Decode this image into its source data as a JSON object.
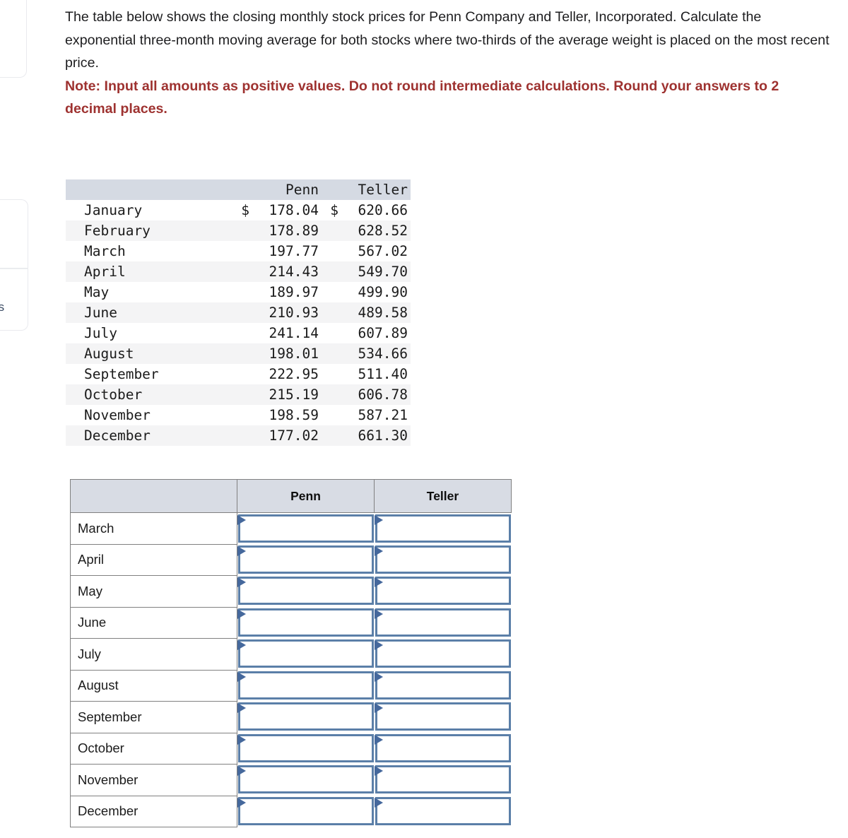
{
  "prompt": {
    "body": "The table below shows the closing monthly stock prices for Penn Company and Teller, Incorporated. Calculate the exponential three-month moving average for both stocks where two-thirds of the average weight is placed on the most recent price.",
    "note": "Note: Input all amounts as positive values. Do not round intermediate calculations. Round your answers to 2 decimal places.",
    "note_color": "#9e3230"
  },
  "edge_cards": {
    "bottom_label": "es"
  },
  "price_table": {
    "headers": [
      "",
      "Penn",
      "Teller"
    ],
    "currency_symbol": "$",
    "rows": [
      {
        "month": "January",
        "penn": "178.04",
        "teller": "620.66",
        "currency": true
      },
      {
        "month": "February",
        "penn": "178.89",
        "teller": "628.52",
        "currency": false
      },
      {
        "month": "March",
        "penn": "197.77",
        "teller": "567.02",
        "currency": false
      },
      {
        "month": "April",
        "penn": "214.43",
        "teller": "549.70",
        "currency": false
      },
      {
        "month": "May",
        "penn": "189.97",
        "teller": "499.90",
        "currency": false
      },
      {
        "month": "June",
        "penn": "210.93",
        "teller": "489.58",
        "currency": false
      },
      {
        "month": "July",
        "penn": "241.14",
        "teller": "607.89",
        "currency": false
      },
      {
        "month": "August",
        "penn": "198.01",
        "teller": "534.66",
        "currency": false
      },
      {
        "month": "September",
        "penn": "222.95",
        "teller": "511.40",
        "currency": false
      },
      {
        "month": "October",
        "penn": "215.19",
        "teller": "606.78",
        "currency": false
      },
      {
        "month": "November",
        "penn": "198.59",
        "teller": "587.21",
        "currency": false
      },
      {
        "month": "December",
        "penn": "177.02",
        "teller": "661.30",
        "currency": false
      }
    ]
  },
  "answer_table": {
    "headers": [
      "",
      "Penn",
      "Teller"
    ],
    "rows": [
      {
        "month": "March",
        "penn": "",
        "teller": ""
      },
      {
        "month": "April",
        "penn": "",
        "teller": ""
      },
      {
        "month": "May",
        "penn": "",
        "teller": ""
      },
      {
        "month": "June",
        "penn": "",
        "teller": ""
      },
      {
        "month": "July",
        "penn": "",
        "teller": ""
      },
      {
        "month": "August",
        "penn": "",
        "teller": ""
      },
      {
        "month": "September",
        "penn": "",
        "teller": ""
      },
      {
        "month": "October",
        "penn": "",
        "teller": ""
      },
      {
        "month": "November",
        "penn": "",
        "teller": ""
      },
      {
        "month": "December",
        "penn": "",
        "teller": ""
      }
    ]
  }
}
